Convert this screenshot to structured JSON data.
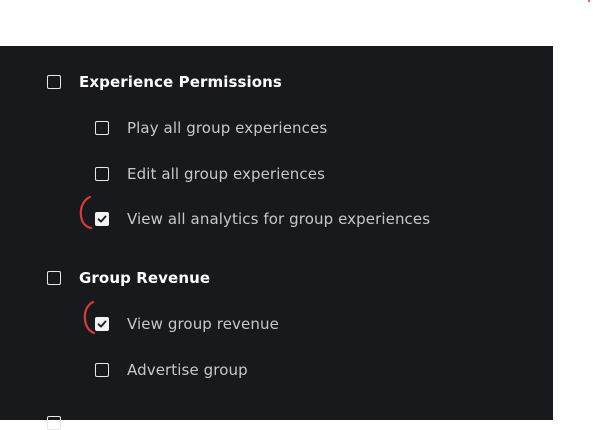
{
  "sections": [
    {
      "header": "Experience Permissions",
      "checked": false,
      "items": [
        {
          "label": "Play all group experiences",
          "checked": false
        },
        {
          "label": "Edit all group experiences",
          "checked": false
        },
        {
          "label": "View all analytics for group experiences",
          "checked": true
        }
      ]
    },
    {
      "header": "Group Revenue",
      "checked": false,
      "items": [
        {
          "label": "View group revenue",
          "checked": true
        },
        {
          "label": "Advertise group",
          "checked": false
        }
      ]
    }
  ],
  "colors": {
    "panel_bg": "#18191c",
    "header_text": "#ffffff",
    "item_text": "#c7c8ca",
    "checkbox": "#e8e8ea",
    "annotation": "#d93a35"
  }
}
